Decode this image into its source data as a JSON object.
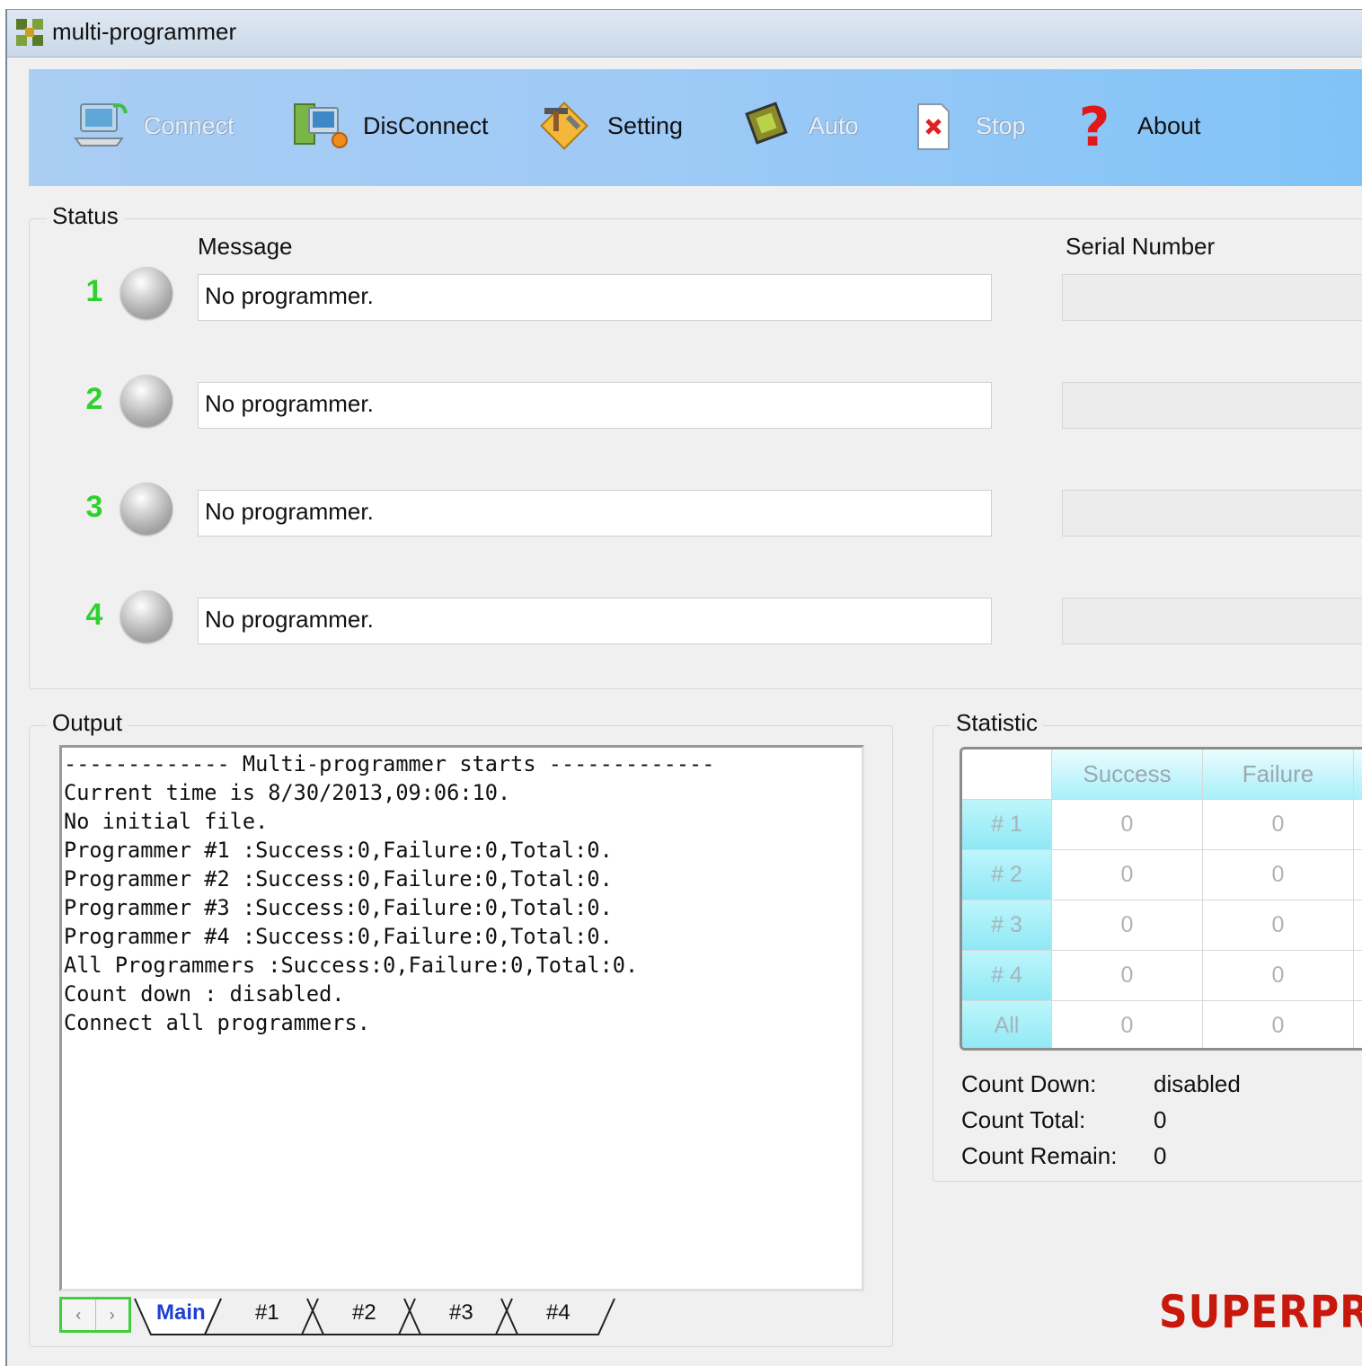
{
  "window": {
    "title": "multi-programmer"
  },
  "toolbar": {
    "items": [
      {
        "label": "Connect",
        "icon": "computer-connect-icon",
        "enabled": false
      },
      {
        "label": "DisConnect",
        "icon": "computer-disconnect-icon",
        "enabled": true
      },
      {
        "label": "Setting",
        "icon": "tools-icon",
        "enabled": true
      },
      {
        "label": "Auto",
        "icon": "chip-icon",
        "enabled": false
      },
      {
        "label": "Stop",
        "icon": "stop-document-icon",
        "enabled": false
      },
      {
        "label": "About",
        "icon": "question-mark-icon",
        "enabled": true
      }
    ]
  },
  "status": {
    "title": "Status",
    "message_header": "Message",
    "serial_header": "Serial Number",
    "rows": [
      {
        "num": "1",
        "message": "No programmer.",
        "serial": ""
      },
      {
        "num": "2",
        "message": "No programmer.",
        "serial": ""
      },
      {
        "num": "3",
        "message": "No programmer.",
        "serial": ""
      },
      {
        "num": "4",
        "message": "No programmer.",
        "serial": ""
      }
    ]
  },
  "output": {
    "title": "Output",
    "lines": [
      "------------- Multi-programmer starts -------------",
      "Current time is 8/30/2013,09:06:10.",
      "No initial file.",
      "Programmer #1 :Success:0,Failure:0,Total:0.",
      "Programmer #2 :Success:0,Failure:0,Total:0.",
      "Programmer #3 :Success:0,Failure:0,Total:0.",
      "Programmer #4 :Success:0,Failure:0,Total:0.",
      "All Programmers :Success:0,Failure:0,Total:0.",
      "Count down : disabled.",
      "Connect all programmers."
    ],
    "tabs": [
      "Main",
      "#1",
      "#2",
      "#3",
      "#4"
    ],
    "active_tab": "Main"
  },
  "statistic": {
    "title": "Statistic",
    "columns": [
      "Success",
      "Failure"
    ],
    "rows": [
      {
        "label": "# 1",
        "success": "0",
        "failure": "0"
      },
      {
        "label": "# 2",
        "success": "0",
        "failure": "0"
      },
      {
        "label": "# 3",
        "success": "0",
        "failure": "0"
      },
      {
        "label": "# 4",
        "success": "0",
        "failure": "0"
      },
      {
        "label": "All",
        "success": "0",
        "failure": "0"
      }
    ],
    "count_down_label": "Count Down:",
    "count_down_value": "disabled",
    "count_total_label": "Count Total:",
    "count_total_value": "0",
    "count_remain_label": "Count Remain:",
    "count_remain_value": "0"
  },
  "brand": {
    "logo_text": "SUPERPRO"
  }
}
